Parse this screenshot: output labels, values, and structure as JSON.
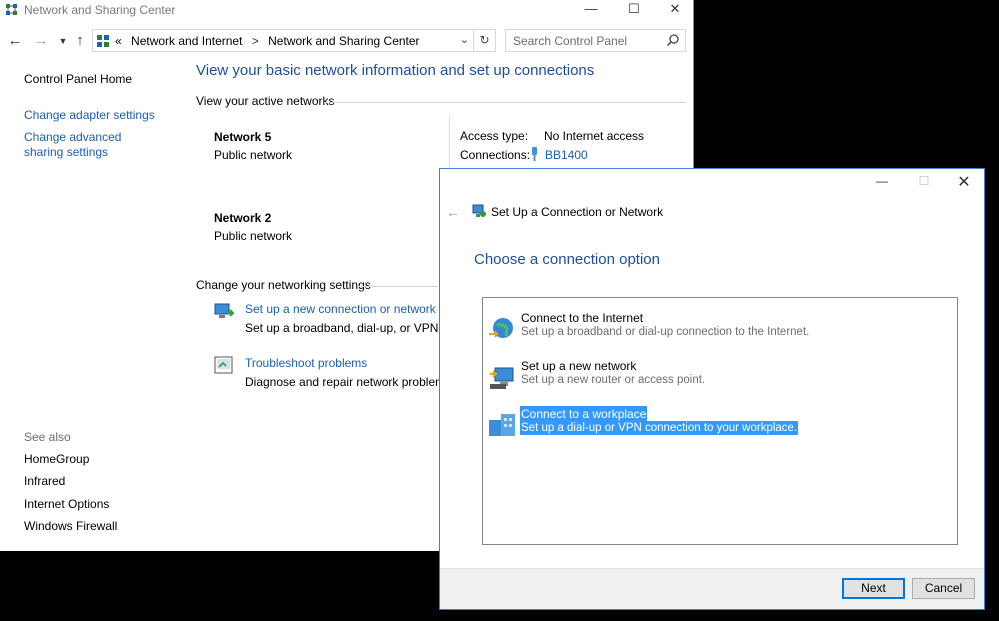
{
  "main_window": {
    "title": "Network and Sharing Center",
    "address": {
      "overflow": "«",
      "crumbs": [
        "Network and Internet",
        "Network and Sharing Center"
      ],
      "separator": ">"
    },
    "search_placeholder": "Search Control Panel",
    "sidebar": {
      "home": "Control Panel Home",
      "links": [
        "Change adapter settings",
        "Change advanced sharing settings"
      ],
      "see_also_label": "See also",
      "see_also": [
        "HomeGroup",
        "Infrared",
        "Internet Options",
        "Windows Firewall"
      ]
    },
    "page_title": "View your basic network information and set up connections",
    "active_networks_heading": "View your active networks",
    "networks": [
      {
        "name": "Network  5",
        "type": "Public network"
      },
      {
        "name": "Network  2",
        "type": "Public network"
      }
    ],
    "access_type_label": "Access type:",
    "access_type_value": "No Internet access",
    "connections_label": "Connections:",
    "connections_value": "BB1400",
    "change_settings_heading": "Change your networking settings",
    "tasks": [
      {
        "link": "Set up a new connection or network",
        "desc": "Set up a broadband, dial-up, or VPN conn"
      },
      {
        "link": "Troubleshoot problems",
        "desc": "Diagnose and repair network problems, o"
      }
    ]
  },
  "dialog": {
    "title": "Set Up a Connection or Network",
    "heading": "Choose a connection option",
    "options": [
      {
        "title": "Connect to the Internet",
        "desc": "Set up a broadband or dial-up connection to the Internet."
      },
      {
        "title": "Set up a new network",
        "desc": "Set up a new router or access point."
      },
      {
        "title": "Connect to a workplace",
        "desc": "Set up a dial-up or VPN connection to your workplace."
      }
    ],
    "selected_option": "Connect to a workplace",
    "next_label": "Next",
    "cancel_label": "Cancel"
  },
  "colors": {
    "link": "#1a5fb4",
    "heading": "#1e4e9c",
    "selection": "#3399ff",
    "dialog_border": "#3b7fd0"
  }
}
